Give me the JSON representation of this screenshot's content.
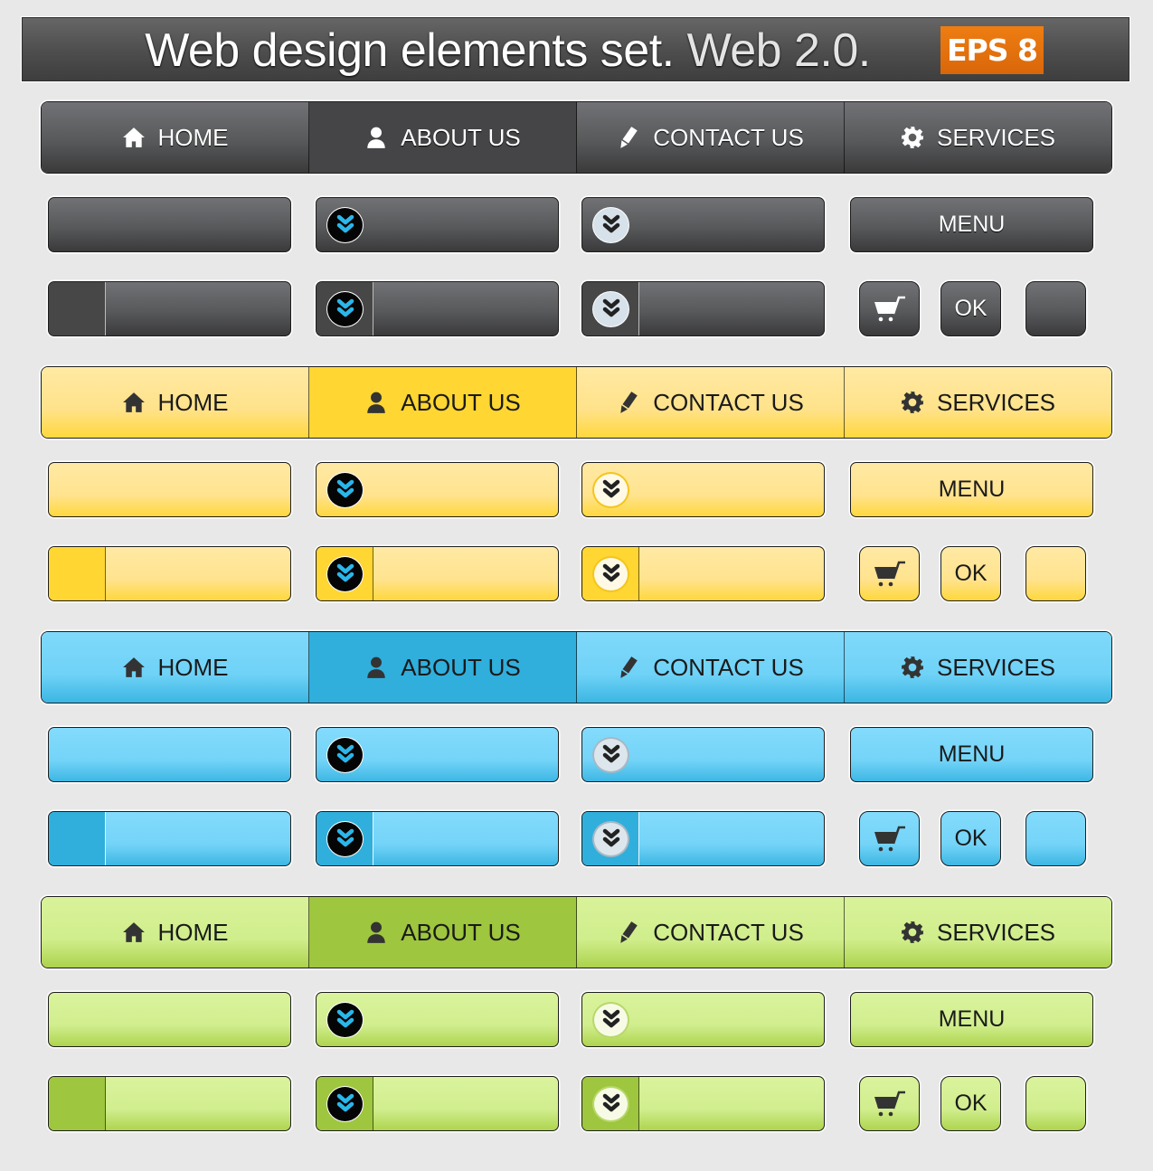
{
  "banner": {
    "title_main": "Web design elements set.",
    "title_light": "Web 2.0.",
    "badge": "EPS 8"
  },
  "colors": {
    "background": "#e8e8e8",
    "badge": "#e8750e",
    "chevron_accent": "#2bb6ea"
  },
  "sets": [
    {
      "theme": "dark",
      "nav": [
        {
          "label": "HOME",
          "icon": "home-icon"
        },
        {
          "label": "ABOUT US",
          "icon": "user-icon",
          "active": true
        },
        {
          "label": "CONTACT US",
          "icon": "pencil-icon"
        },
        {
          "label": "SERVICES",
          "icon": "gear-icon"
        }
      ],
      "menu_label": "MENU",
      "ok_label": "OK",
      "base_color": "#58595b",
      "active_color": "#454547"
    },
    {
      "theme": "yellow",
      "nav": [
        {
          "label": "HOME",
          "icon": "home-icon"
        },
        {
          "label": "ABOUT US",
          "icon": "user-icon",
          "active": true
        },
        {
          "label": "CONTACT US",
          "icon": "pencil-icon"
        },
        {
          "label": "SERVICES",
          "icon": "gear-icon"
        }
      ],
      "menu_label": "MENU",
      "ok_label": "OK",
      "base_color": "#ffe28a",
      "active_color": "#ffd632"
    },
    {
      "theme": "blue",
      "nav": [
        {
          "label": "HOME",
          "icon": "home-icon"
        },
        {
          "label": "ABOUT US",
          "icon": "user-icon",
          "active": true
        },
        {
          "label": "CONTACT US",
          "icon": "pencil-icon"
        },
        {
          "label": "SERVICES",
          "icon": "gear-icon"
        }
      ],
      "menu_label": "MENU",
      "ok_label": "OK",
      "base_color": "#6fd2f7",
      "active_color": "#30afdd"
    },
    {
      "theme": "green",
      "nav": [
        {
          "label": "HOME",
          "icon": "home-icon"
        },
        {
          "label": "ABOUT US",
          "icon": "user-icon",
          "active": true
        },
        {
          "label": "CONTACT US",
          "icon": "pencil-icon"
        },
        {
          "label": "SERVICES",
          "icon": "gear-icon"
        }
      ],
      "menu_label": "MENU",
      "ok_label": "OK",
      "base_color": "#d0ee8c",
      "active_color": "#9ec63e"
    }
  ]
}
